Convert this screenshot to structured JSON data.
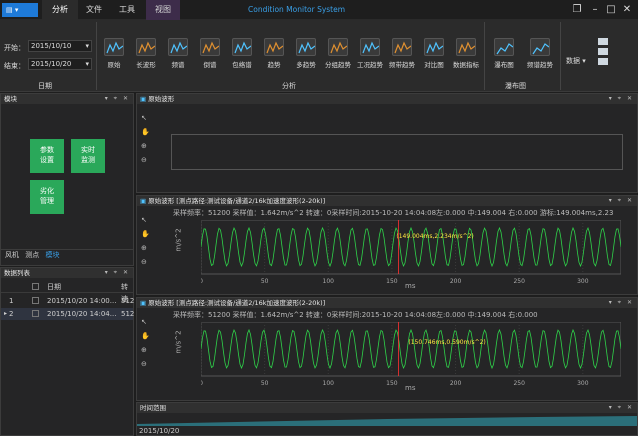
{
  "app": {
    "title": "Condition Monitor System"
  },
  "tabs": [
    "分析",
    "文件",
    "工具",
    "视图"
  ],
  "ribbon": {
    "start_label": "开始：",
    "start_value": "2015/10/10",
    "end_label": "结束：",
    "end_value": "2015/10/20",
    "date_group": "日期",
    "analysis_group": "分析",
    "waterfall_group": "瀑布图",
    "data_label": "数据",
    "buttons": [
      "原始",
      "长波形",
      "频谱",
      "倒谱",
      "包络谱",
      "趋势",
      "多趋势",
      "分组趋势",
      "工况趋势",
      "频带趋势",
      "对比图",
      "数据指标"
    ],
    "waterfall_buttons": [
      "瀑布图",
      "频谱趋势"
    ]
  },
  "module_panel": {
    "title": "模块",
    "buttons": [
      "参数\n设置",
      "实时\n监测",
      "劣化\n管理"
    ],
    "tabs": [
      "风机",
      "测点",
      "模块"
    ]
  },
  "data_list": {
    "title": "数据列表",
    "header_date": "日期",
    "header_sn": "转速",
    "rows": [
      {
        "idx": "1",
        "date": "2015/10/20 14:00...",
        "val": "512"
      },
      {
        "idx": "2",
        "date": "2015/10/20 14:04...",
        "val": "512"
      }
    ]
  },
  "waves": [
    {
      "title": "原始波形",
      "empty": true
    },
    {
      "title": "原始波形 [测点路径:测试设备/通道2/16k加速度波形(2-20k)]",
      "info": "采样频率：51200   采样值：1.642m/s^2   转速：0采样时间:2015-10-20 14:04:08左:0.000  中:149.004  右:0.000    游标:149.004ms,2.23",
      "ylabel": "m/s^2",
      "xlabel": "ms",
      "cursor_label": "(149.004ms,2.234m/s^2)",
      "cursor_color": "#ff3030",
      "xticks": [
        "0",
        "50",
        "100",
        "150",
        "200",
        "250",
        "300"
      ],
      "yticks": [
        "2",
        "0",
        "-2"
      ]
    },
    {
      "title": "原始波形 [测点路径:测试设备/通道2/16k加速度波形(2-20k)]",
      "info": "采样频率：51200   采样值：1.642m/s^2   转速：0采样时间:2015-10-20 14:04:08左:0.000  中:149.004  右:0.000",
      "ylabel": "m/s^2",
      "xlabel": "ms",
      "cursor_label": "(150.746ms,0.590m/s^2)",
      "cursor_color": "#ff3030",
      "xticks": [
        "0",
        "50",
        "100",
        "150",
        "200",
        "250",
        "300"
      ],
      "yticks": [
        "2",
        "0",
        "-2"
      ]
    }
  ],
  "time_range": {
    "title": "时间范围",
    "date": "2015/10/20"
  },
  "colors": {
    "wave": "#2fd34a",
    "accent": "#1e7ad8",
    "grid": "#3a3a3a"
  }
}
